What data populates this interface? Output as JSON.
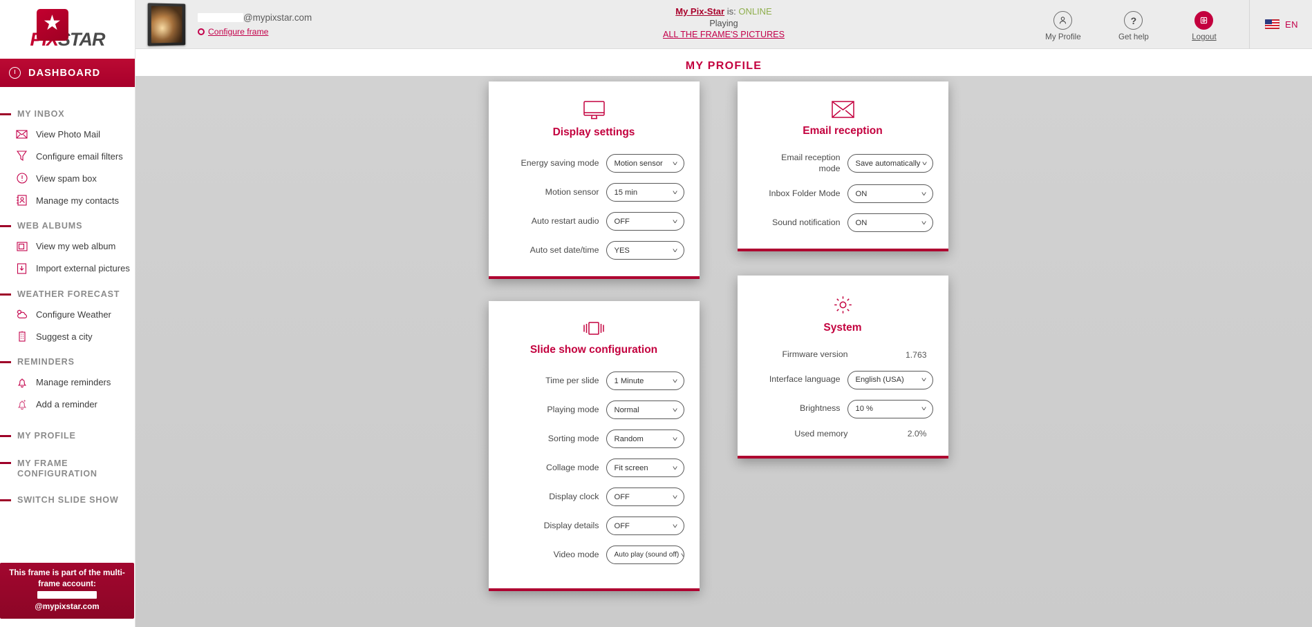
{
  "brand": {
    "name_pix": "PIX",
    "name_star": "STAR",
    "star_glyph": "★"
  },
  "sidebar": {
    "dashboard": {
      "label": "DASHBOARD",
      "icon": "clock-icon"
    },
    "groups": [
      {
        "title": "MY INBOX",
        "items": [
          {
            "label": "View Photo Mail",
            "icon": "envelope-icon"
          },
          {
            "label": "Configure email filters",
            "icon": "funnel-icon"
          },
          {
            "label": "View spam box",
            "icon": "alert-circle-icon"
          },
          {
            "label": "Manage my contacts",
            "icon": "contacts-icon"
          }
        ]
      },
      {
        "title": "WEB ALBUMS",
        "items": [
          {
            "label": "View my web album",
            "icon": "album-icon"
          },
          {
            "label": "Import external pictures",
            "icon": "import-download-icon"
          }
        ]
      },
      {
        "title": "WEATHER FORECAST",
        "items": [
          {
            "label": "Configure Weather",
            "icon": "weather-cloud-icon"
          },
          {
            "label": "Suggest a city",
            "icon": "city-building-icon"
          }
        ]
      },
      {
        "title": "REMINDERS",
        "items": [
          {
            "label": "Manage reminders",
            "icon": "bell-icon"
          },
          {
            "label": "Add a reminder",
            "icon": "bell-add-icon"
          }
        ]
      },
      {
        "title": "MY PROFILE",
        "items": []
      },
      {
        "title": "MY FRAME CONFIGURATION",
        "items": []
      },
      {
        "title": "SWITCH SLIDE SHOW",
        "items": []
      }
    ],
    "multiframe_badge": {
      "line1": "This frame is part of the multi-",
      "line2": "frame account:",
      "line3_suffix": "@mypixstar.com"
    }
  },
  "topbar": {
    "frame_email_suffix": "@mypixstar.com",
    "configure_frame": "Configure frame",
    "status": {
      "device_link": "My Pix-Star",
      "is_word": "is:",
      "state": "ONLINE",
      "playing_label": "Playing",
      "playing_target": "ALL THE FRAME'S PICTURES"
    },
    "actions": [
      {
        "label": "My Profile",
        "icon": "user-icon",
        "glyph": "\u0001",
        "style": "outline"
      },
      {
        "label": "Get help",
        "icon": "question-mark-icon",
        "glyph": "?",
        "style": "outline"
      },
      {
        "label": "Logout",
        "icon": "logout-icon",
        "glyph": "\u0001",
        "style": "solid"
      }
    ],
    "language": {
      "code": "EN",
      "icon": "usa-flag-icon"
    }
  },
  "page": {
    "title": "MY PROFILE"
  },
  "cards": {
    "display_settings": {
      "title": "Display settings",
      "icon": "monitor-icon",
      "rows": [
        {
          "label": "Energy saving mode",
          "value": "Motion sensor",
          "type": "select"
        },
        {
          "label": "Motion sensor",
          "value": "15 min",
          "type": "select"
        },
        {
          "label": "Auto restart audio",
          "value": "OFF",
          "type": "select"
        },
        {
          "label": "Auto set date/time",
          "value": "YES",
          "type": "select"
        }
      ]
    },
    "slide_show": {
      "title": "Slide show configuration",
      "icon": "slideshow-icon",
      "rows": [
        {
          "label": "Time per slide",
          "value": "1 Minute",
          "type": "select"
        },
        {
          "label": "Playing mode",
          "value": "Normal",
          "type": "select"
        },
        {
          "label": "Sorting mode",
          "value": "Random",
          "type": "select"
        },
        {
          "label": "Collage mode",
          "value": "Fit screen",
          "type": "select"
        },
        {
          "label": "Display clock",
          "value": "OFF",
          "type": "select"
        },
        {
          "label": "Display details",
          "value": "OFF",
          "type": "select"
        },
        {
          "label": "Video mode",
          "value": "Auto play (sound off)",
          "type": "select"
        }
      ]
    },
    "email_reception": {
      "title": "Email reception",
      "icon": "envelope-icon",
      "rows": [
        {
          "label": "Email reception mode",
          "value": "Save automatically",
          "type": "select"
        },
        {
          "label": "Inbox Folder Mode",
          "value": "ON",
          "type": "select"
        },
        {
          "label": "Sound notification",
          "value": "ON",
          "type": "select"
        }
      ]
    },
    "system": {
      "title": "System",
      "icon": "gear-icon",
      "rows": [
        {
          "label": "Firmware version",
          "value": "1.763",
          "type": "text"
        },
        {
          "label": "Interface language",
          "value": "English (USA)",
          "type": "select"
        },
        {
          "label": "Brightness",
          "value": "10 %",
          "type": "select"
        },
        {
          "label": "Used memory",
          "value": "2.0%",
          "type": "text"
        }
      ]
    }
  },
  "colors": {
    "brand_red": "#c3003e",
    "brand_dark_red": "#a8002b",
    "online_green": "#8fae4d",
    "content_bg": "#cfcfcf"
  }
}
